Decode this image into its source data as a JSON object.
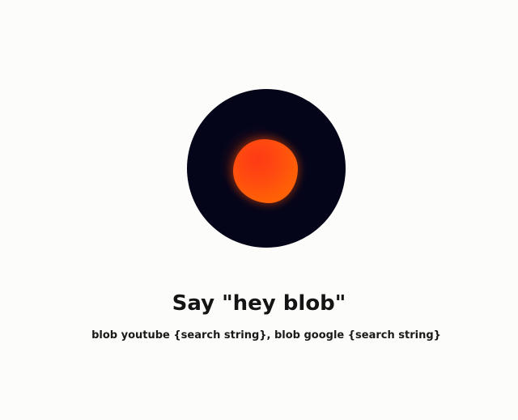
{
  "prompt": {
    "title": "Say \"hey blob\"",
    "subtitle": "blob youtube {search string}, blob google {search string}"
  },
  "colors": {
    "background": "#fcfcfa",
    "orb": "#05051a",
    "blob": "#ff4a10"
  }
}
